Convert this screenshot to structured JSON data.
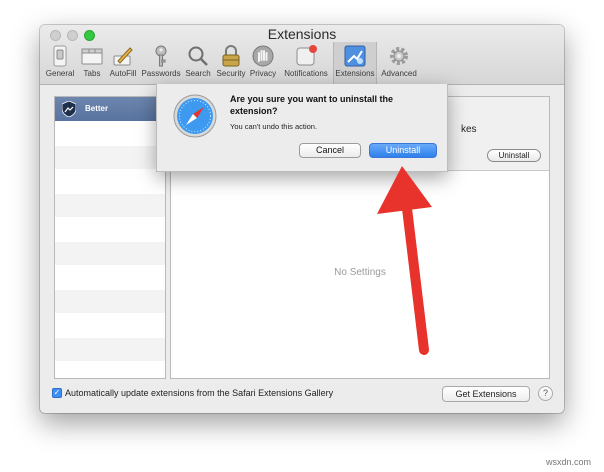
{
  "window": {
    "title": "Extensions"
  },
  "toolbar": [
    {
      "label": "General",
      "icon": "switch-icon"
    },
    {
      "label": "Tabs",
      "icon": "tabs-icon"
    },
    {
      "label": "AutoFill",
      "icon": "pencil-icon"
    },
    {
      "label": "Passwords",
      "icon": "key-icon"
    },
    {
      "label": "Search",
      "icon": "magnifier-icon"
    },
    {
      "label": "Security",
      "icon": "padlock-icon"
    },
    {
      "label": "Privacy",
      "icon": "hand-icon"
    },
    {
      "label": "Notifications",
      "icon": "notification-icon"
    },
    {
      "label": "Extensions",
      "icon": "puzzle-icon"
    },
    {
      "label": "Advanced",
      "icon": "gear-icon"
    }
  ],
  "sidebar": {
    "selected_extension": "Better"
  },
  "detail": {
    "name_fragment": "kes",
    "uninstall_label": "Uninstall",
    "empty_text": "No Settings"
  },
  "footer": {
    "auto_update_checked": true,
    "auto_update_label": "Automatically update extensions from the Safari Extensions Gallery",
    "get_extensions_label": "Get Extensions",
    "help_label": "?"
  },
  "alert": {
    "title": "Are you sure you want to uninstall the extension?",
    "message": "You can't undo this action.",
    "cancel_label": "Cancel",
    "confirm_label": "Uninstall"
  },
  "colors": {
    "accent_blue": "#2f80ec",
    "arrow_red": "#e8322c",
    "selection": "#5f79a6"
  },
  "watermark": "wsxdn.com"
}
